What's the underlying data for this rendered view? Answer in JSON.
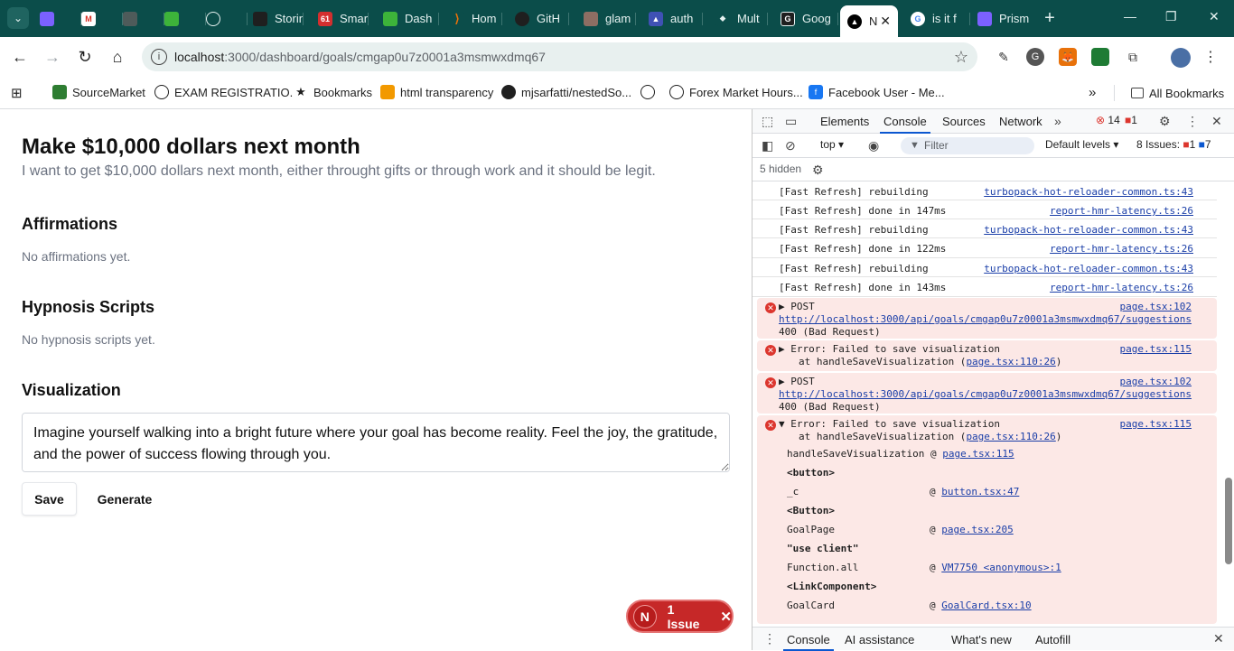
{
  "browser": {
    "tabs": [
      {
        "label": "",
        "color": "#7b61ff"
      },
      {
        "label": "",
        "color": "#d93025"
      },
      {
        "label": "",
        "color": "#4e5b5a"
      },
      {
        "label": "",
        "color": "#3db33a"
      },
      {
        "label": "",
        "color": "#1f1f1f"
      },
      {
        "label": "Storin",
        "color": "#1f1f1f"
      },
      {
        "label": "Smar",
        "color": "#d32f2f"
      },
      {
        "label": "Dash",
        "color": "#3db33a"
      },
      {
        "label": "Hom",
        "color": "#e8710a"
      },
      {
        "label": "GitH",
        "color": "#1f1f1f"
      },
      {
        "label": "glam",
        "color": "#8d6e63"
      },
      {
        "label": "auth",
        "color": "#3f51b5"
      },
      {
        "label": "Mult",
        "color": "#1f1f1f"
      },
      {
        "label": "Goog",
        "color": "#1f1f1f"
      },
      {
        "label": "N",
        "color": "#000000"
      },
      {
        "label": "is it f",
        "color": "#4285f4"
      },
      {
        "label": "Prism",
        "color": "#7b61ff"
      }
    ],
    "active_tab_close": "✕",
    "new_tab": "+",
    "url_host": "localhost",
    "url_path": ":3000/dashboard/goals/cmgap0u7z0001a3msmwxdmq67",
    "bookmarks": [
      {
        "label": "SourceMarket",
        "color": "#2e7d32"
      },
      {
        "label": "EXAM REGISTRATIO...",
        "color": "#1f1f1f"
      },
      {
        "label": "Bookmarks",
        "color": "#1f1f1f"
      },
      {
        "label": "html transparency",
        "color": "#f29900"
      },
      {
        "label": "mjsarfatti/nestedSo...",
        "color": "#1f1f1f"
      },
      {
        "label": "",
        "color": "#1f1f1f"
      },
      {
        "label": "Forex Market Hours...",
        "color": "#1f1f1f"
      },
      {
        "label": "Facebook User - Me...",
        "color": "#1877f2"
      }
    ],
    "more_bookmarks": "»",
    "all_bookmarks": "All Bookmarks"
  },
  "page": {
    "title": "Make $10,000 dollars next month",
    "description": "I want to get $10,000 dollars next month, either throught gifts or through work and it should be legit.",
    "affirmations_heading": "Affirmations",
    "affirmations_empty": "No affirmations yet.",
    "hypnosis_heading": "Hypnosis Scripts",
    "hypnosis_empty": "No hypnosis scripts yet.",
    "visualization_heading": "Visualization",
    "visualization_text": "Imagine yourself walking into a bright future where your goal has become reality. Feel the joy, the gratitude, and the power of success flowing through you.",
    "save_label": "Save",
    "generate_label": "Generate",
    "issue_badge": "N",
    "issue_label": "1 Issue"
  },
  "devtools": {
    "tabs": [
      "Elements",
      "Console",
      "Sources",
      "Network"
    ],
    "active_tab": "Console",
    "error_count": "14",
    "warn_count": "1",
    "context": "top",
    "filter_placeholder": "Filter",
    "levels": "Default levels",
    "issues_label": "8 Issues:",
    "issues_err": "1",
    "issues_info": "7",
    "hidden": "5 hidden",
    "logs": [
      {
        "msg": "[Fast Refresh] rebuilding",
        "src": "turbopack-hot-reloader-common.ts:43"
      },
      {
        "msg": "[Fast Refresh] done in 147ms",
        "src": "report-hmr-latency.ts:26"
      },
      {
        "msg": "[Fast Refresh] rebuilding",
        "src": "turbopack-hot-reloader-common.ts:43"
      },
      {
        "msg": "[Fast Refresh] done in 122ms",
        "src": "report-hmr-latency.ts:26"
      },
      {
        "msg": "[Fast Refresh] rebuilding",
        "src": "turbopack-hot-reloader-common.ts:43"
      },
      {
        "msg": "[Fast Refresh] done in 143ms",
        "src": "report-hmr-latency.ts:26"
      }
    ],
    "post1": {
      "method": "POST",
      "src": "page.tsx:102",
      "url": "http://localhost:3000/api/goals/cmgap0u7z0001a3msmwxdmq67/suggestions",
      "status": "400 (Bad Request)"
    },
    "err1": {
      "msg": "Error: Failed to save visualization",
      "at": "at handleSaveVisualization (",
      "link": "page.tsx:110:26",
      "close": ")",
      "src": "page.tsx:115"
    },
    "post2": {
      "method": "POST",
      "src": "page.tsx:102",
      "url": "http://localhost:3000/api/goals/cmgap0u7z0001a3msmwxdmq67/suggestions",
      "status": "400 (Bad Request)"
    },
    "err2": {
      "msg": "Error: Failed to save visualization",
      "at": "at handleSaveVisualization (",
      "link": "page.tsx:110:26",
      "close": ")",
      "src": "page.tsx:115"
    },
    "stack": [
      {
        "name": "handleSaveVisualization @",
        "link": "page.tsx:115",
        "bold": false,
        "inline": true
      },
      {
        "name": "<button>",
        "link": "",
        "bold": true
      },
      {
        "name": "_c",
        "link": "button.tsx:47",
        "bold": false
      },
      {
        "name": "<Button>",
        "link": "",
        "bold": true
      },
      {
        "name": "GoalPage",
        "link": "page.tsx:205",
        "bold": false
      },
      {
        "name": "\"use client\"",
        "link": "",
        "bold": true
      },
      {
        "name": "Function.all",
        "link": "VM7750 <anonymous>:1",
        "bold": false
      },
      {
        "name": "<LinkComponent>",
        "link": "",
        "bold": true
      },
      {
        "name": "GoalCard",
        "link": "GoalCard.tsx:10",
        "bold": false
      }
    ],
    "bottom_tabs": [
      "Console",
      "AI assistance",
      "What's new",
      "Autofill"
    ]
  }
}
